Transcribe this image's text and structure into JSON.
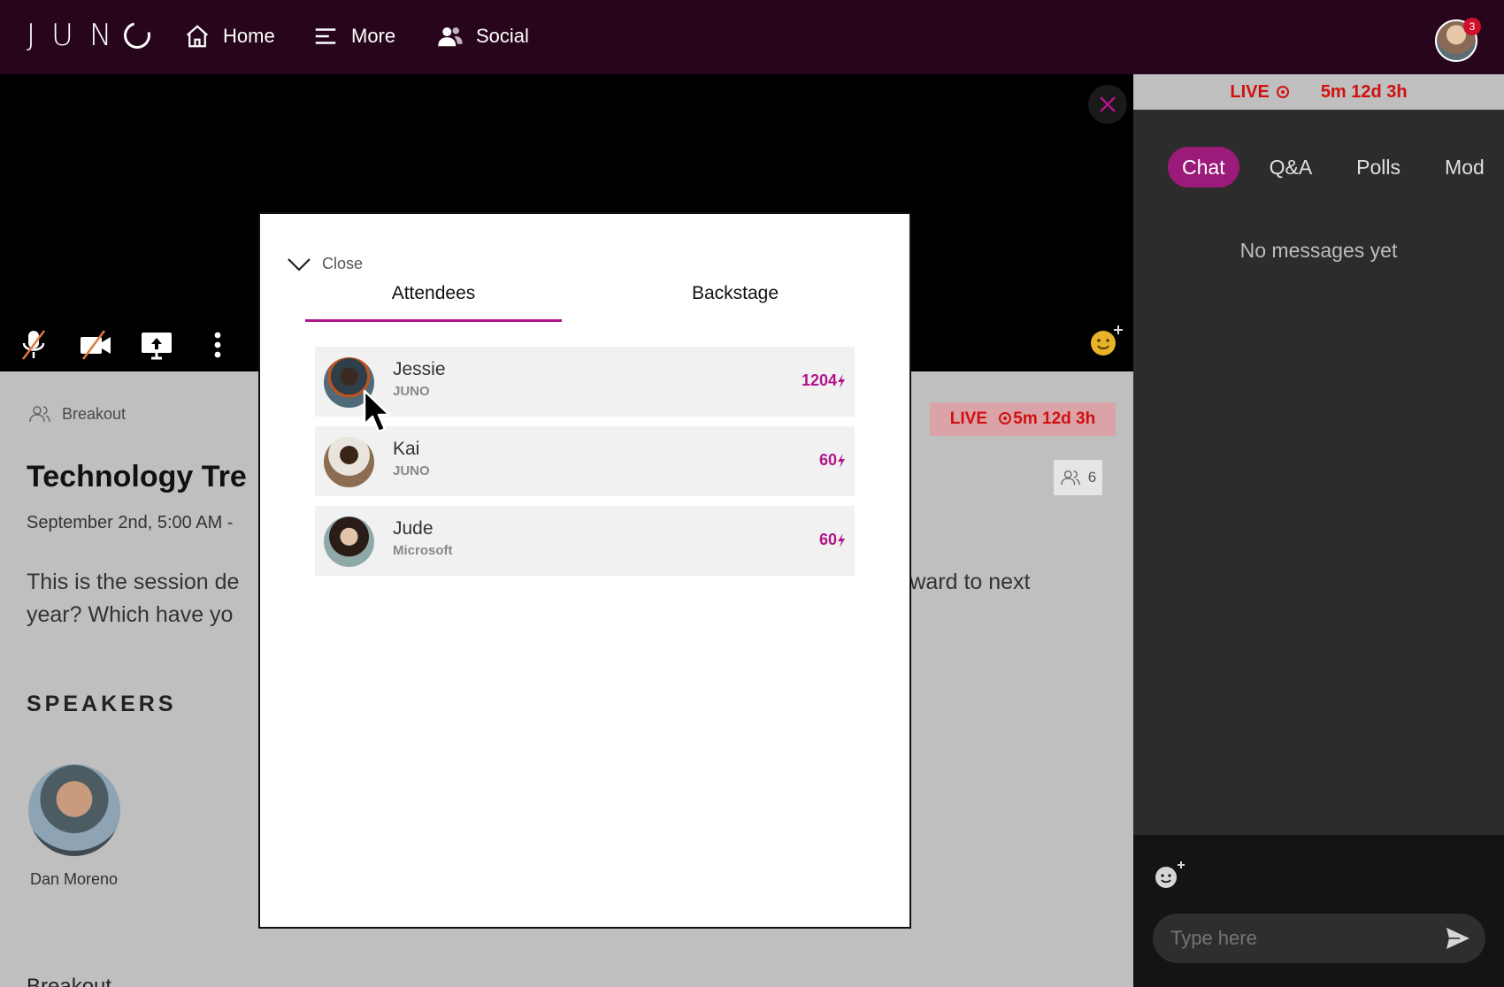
{
  "nav": {
    "logo": "JUN",
    "items": [
      {
        "label": "Home",
        "icon": "home-icon"
      },
      {
        "label": "More",
        "icon": "menu-icon"
      },
      {
        "label": "Social",
        "icon": "people-icon"
      }
    ],
    "notification_count": "3"
  },
  "session": {
    "type_label": "Breakout",
    "live_label": "LIVE",
    "live_timer": "5m 12d 3h",
    "attendee_count": "6",
    "title": "Technology Tre",
    "date": "September 2nd, 5:00 AM -",
    "description_line1_left": "This is the session de",
    "description_line1_right": "rward to next",
    "description_line2": "year? Which have yo",
    "speakers_heading": "SPEAKERS",
    "speakers": [
      {
        "name": "Dan Moreno"
      }
    ],
    "next_section_cut": "Breakout"
  },
  "right_panel": {
    "live_label": "LIVE",
    "live_timer": "5m 12d 3h",
    "tabs": [
      "Chat",
      "Q&A",
      "Polls",
      "Mod"
    ],
    "active_tab": "Chat",
    "empty_message": "No messages yet",
    "input_placeholder": "Type here"
  },
  "modal": {
    "close_label": "Close",
    "tabs": [
      "Attendees",
      "Backstage"
    ],
    "active_tab": "Attendees",
    "attendees": [
      {
        "name": "Jessie",
        "org": "JUNO",
        "points": "1204"
      },
      {
        "name": "Kai",
        "org": "JUNO",
        "points": "60"
      },
      {
        "name": "Jude",
        "org": "Microsoft",
        "points": "60"
      }
    ]
  },
  "colors": {
    "nav_bg": "#27061c",
    "accent": "#b0158a",
    "live_red": "#d01010",
    "panel_bg": "#2c2c2c"
  }
}
